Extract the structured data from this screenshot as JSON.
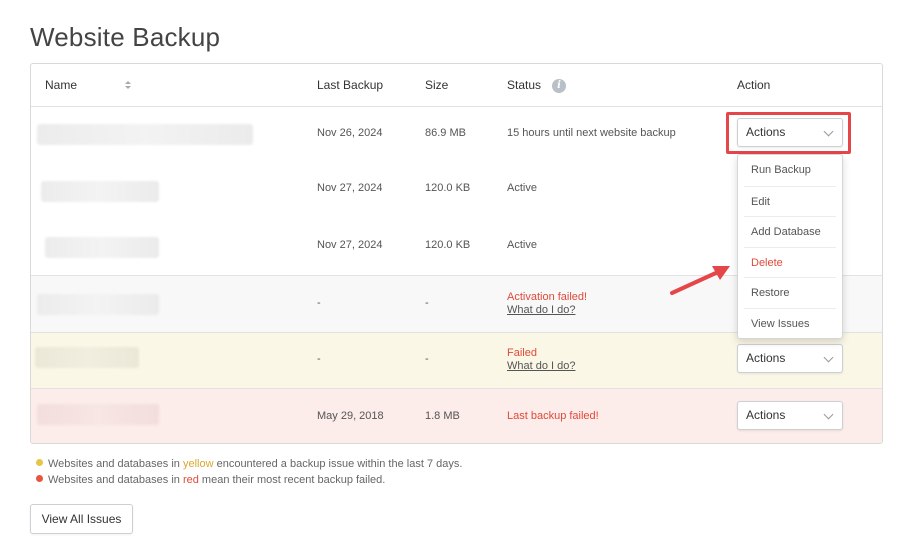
{
  "page_title": "Website Backup",
  "table": {
    "headers": {
      "name": "Name",
      "last_backup": "Last Backup",
      "size": "Size",
      "status": "Status",
      "action": "Action"
    },
    "rows": [
      {
        "last_backup": "Nov 26, 2024",
        "size": "86.9 MB",
        "status": "15 hours until next website backup",
        "status_link": "",
        "state": "normal"
      },
      {
        "last_backup": "Nov 27, 2024",
        "size": "120.0 KB",
        "status": "Active",
        "status_link": "",
        "state": "normal"
      },
      {
        "last_backup": "Nov 27, 2024",
        "size": "120.0 KB",
        "status": "Active",
        "status_link": "",
        "state": "normal"
      },
      {
        "last_backup": "-",
        "size": "-",
        "status": "Activation failed!",
        "status_link": "What do I do?",
        "state": "gray"
      },
      {
        "last_backup": "-",
        "size": "-",
        "status": "Failed",
        "status_link": "What do I do?",
        "state": "yellow"
      },
      {
        "last_backup": "May 29, 2018",
        "size": "1.8 MB",
        "status": "Last backup failed!",
        "status_link": "",
        "state": "red"
      }
    ],
    "actions_label": "Actions"
  },
  "actions_menu": {
    "items": [
      "Run Backup",
      "Edit",
      "Add Database",
      "Delete",
      "Restore",
      "View Issues"
    ]
  },
  "legend": {
    "yellow": {
      "before": "Websites and databases in ",
      "word": "yellow",
      "after": " encountered a backup issue within the last 7 days.",
      "color": "#e8c547"
    },
    "red": {
      "before": "Websites and databases in ",
      "word": "red",
      "after": " mean their most recent backup failed.",
      "color": "#e8553f"
    }
  },
  "view_all_label": "View All Issues",
  "colors": {
    "highlight": "#e4464a",
    "error_text": "#e04a3a",
    "row_yellow": "#faf7e6",
    "row_red": "#fcecea"
  }
}
